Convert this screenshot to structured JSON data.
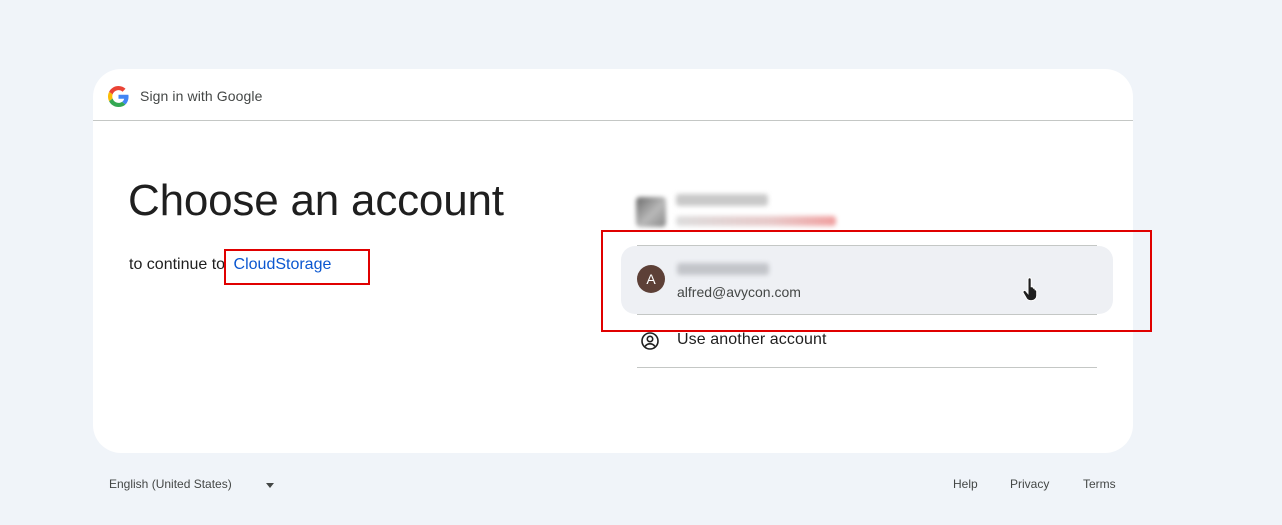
{
  "header": {
    "text": "Sign in with Google",
    "logo_icon": "google-g-logo"
  },
  "main": {
    "title": "Choose an account",
    "subtitle_prefix": "to continue to",
    "app_name": "CloudStorage"
  },
  "accounts": [
    {
      "name": "",
      "email": "",
      "obscured": true
    },
    {
      "avatar_initial": "A",
      "avatar_color": "#5d4037",
      "name": "",
      "email": "alfred@avycon.com",
      "obscured_name": true,
      "highlighted": true
    }
  ],
  "use_another": {
    "label": "Use another account",
    "icon": "account-circle-icon"
  },
  "footer": {
    "language": "English (United States)",
    "links": [
      "Help",
      "Privacy",
      "Terms"
    ]
  },
  "colors": {
    "background": "#f0f4f9",
    "link": "#0b57d0",
    "annotation_red": "#e00000",
    "selected_row": "#eef0f4"
  }
}
